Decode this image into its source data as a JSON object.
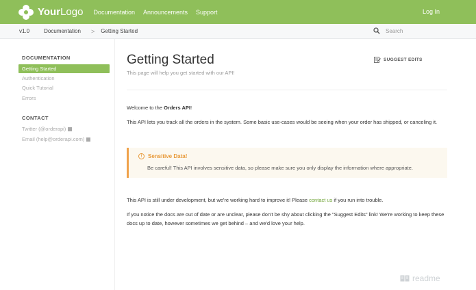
{
  "nav": {
    "logo_prefix": "Your",
    "logo_suffix": "Logo",
    "links": [
      "Documentation",
      "Announcements",
      "Support"
    ],
    "login": "Log In",
    "brand_color": "#8fbf5a"
  },
  "breadcrumb": {
    "version": "v1.0",
    "section": "Documentation",
    "separator": ">",
    "current": "Getting Started"
  },
  "search": {
    "placeholder": "Search",
    "icon": "search-icon"
  },
  "sidebar": {
    "docs_heading": "DOCUMENTATION",
    "docs_items": [
      "Getting Started",
      "Authentication",
      "Quick Tutorial",
      "Errors"
    ],
    "contact_heading": "CONTACT",
    "contact_items": [
      "Twitter (@orderapi)",
      "Email (help@orderapi.com)"
    ]
  },
  "page": {
    "title": "Getting Started",
    "subtitle": "This page will help you get started with our API!",
    "suggest_edits": "SUGGEST EDITS",
    "welcome_prefix": "Welcome to the ",
    "welcome_bold": "Orders API",
    "welcome_suffix": "!",
    "intro": "This API lets you track all the orders in the system. Some basic use-cases would be seeing when your order has shipped, or canceling it.",
    "callout_title": "Sensitive Data!",
    "callout_icon": "!",
    "callout_body": "Be careful! This API involves sensitive data, so please make sure you only display the information where appropriate.",
    "dev_prefix": "This API is still under development, but we're working hard to improve it! Please ",
    "dev_link": "contact us",
    "dev_suffix": " if you run into trouble.",
    "outdated": "If you notice the docs are out of date or are unclear, please don't be shy about clicking the \"Suggest Edits\" link! We're working to keep these docs up to date, however sometimes we get behind – and we'd love your help."
  },
  "footer": {
    "readme": "readme"
  }
}
